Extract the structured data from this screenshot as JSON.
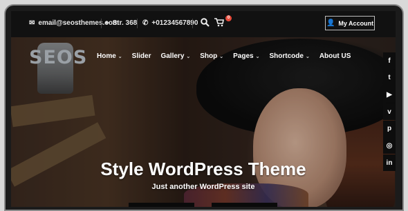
{
  "topbar": {
    "email": "email@seosthemes.com",
    "address": "Str. 368",
    "phone": "+01234567890",
    "cart_count": "0",
    "account_label": "My Account"
  },
  "logo": {
    "text": "SEOS"
  },
  "nav": [
    {
      "label": "Home",
      "dropdown": true
    },
    {
      "label": "Slider",
      "dropdown": false
    },
    {
      "label": "Gallery",
      "dropdown": true
    },
    {
      "label": "Shop",
      "dropdown": true
    },
    {
      "label": "Pages",
      "dropdown": true
    },
    {
      "label": "Shortcode",
      "dropdown": true
    },
    {
      "label": "About US",
      "dropdown": false
    }
  ],
  "social": [
    {
      "icon": "facebook-icon",
      "glyph": "f"
    },
    {
      "icon": "twitter-icon",
      "glyph": "t"
    },
    {
      "icon": "youtube-icon",
      "glyph": "▶"
    },
    {
      "icon": "vimeo-icon",
      "glyph": "v"
    },
    {
      "icon": "pinterest-icon",
      "glyph": "p"
    },
    {
      "icon": "instagram-icon",
      "glyph": "◎"
    },
    {
      "icon": "linkedin-icon",
      "glyph": "in"
    }
  ],
  "hero": {
    "title": "Style WordPress Theme",
    "subtitle": "Just another WordPress site"
  }
}
